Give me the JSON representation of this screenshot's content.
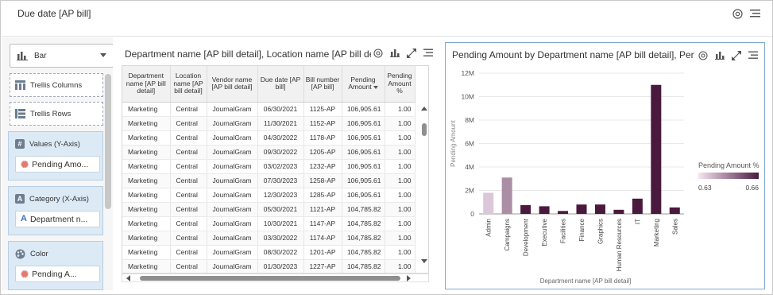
{
  "header": {
    "title": "Due date [AP bill]"
  },
  "left_panel": {
    "chart_type": "Bar",
    "trellis_columns": "Trellis Columns",
    "trellis_rows": "Trellis Rows",
    "values_well": {
      "label": "Values (Y-Axis)",
      "item": "Pending Amo..."
    },
    "category_well": {
      "label": "Category (X-Axis)",
      "item": "Department n..."
    },
    "color_well": {
      "label": "Color",
      "item": "Pending A..."
    }
  },
  "table_panel": {
    "title": "Department name [AP bill detail], Location name [AP bill detail], Ve",
    "columns": [
      "Department name [AP bill detail]",
      "Location name [AP bill detail]",
      "Vendor name [AP bill detail]",
      "Due date [AP bill]",
      "Bill number [AP bill]",
      "Pending Amount",
      "Pending Amount %"
    ],
    "rows": [
      [
        "Marketing",
        "Central",
        "JournalGram",
        "06/30/2021",
        "1125-AP",
        "106,905.61",
        "1.00"
      ],
      [
        "Marketing",
        "Central",
        "JournalGram",
        "11/30/2021",
        "1152-AP",
        "106,905.61",
        "1.00"
      ],
      [
        "Marketing",
        "Central",
        "JournalGram",
        "04/30/2022",
        "1178-AP",
        "106,905.61",
        "1.00"
      ],
      [
        "Marketing",
        "Central",
        "JournalGram",
        "09/30/2022",
        "1205-AP",
        "106,905.61",
        "1.00"
      ],
      [
        "Marketing",
        "Central",
        "JournalGram",
        "03/02/2023",
        "1232-AP",
        "106,905.61",
        "1.00"
      ],
      [
        "Marketing",
        "Central",
        "JournalGram",
        "07/30/2023",
        "1258-AP",
        "106,905.61",
        "1.00"
      ],
      [
        "Marketing",
        "Central",
        "JournalGram",
        "12/30/2023",
        "1285-AP",
        "106,905.61",
        "1.00"
      ],
      [
        "Marketing",
        "Central",
        "JournalGram",
        "05/30/2021",
        "1121-AP",
        "104,785.82",
        "1.00"
      ],
      [
        "Marketing",
        "Central",
        "JournalGram",
        "10/30/2021",
        "1147-AP",
        "104,785.82",
        "1.00"
      ],
      [
        "Marketing",
        "Central",
        "JournalGram",
        "03/30/2022",
        "1174-AP",
        "104,785.82",
        "1.00"
      ],
      [
        "Marketing",
        "Central",
        "JournalGram",
        "08/30/2022",
        "1201-AP",
        "104,785.82",
        "1.00"
      ],
      [
        "Marketing",
        "Central",
        "JournalGram",
        "01/30/2023",
        "1227-AP",
        "104,785.82",
        "1.00"
      ]
    ]
  },
  "chart_panel": {
    "title": "Pending Amount by Department name [AP bill detail], Pending Am"
  },
  "chart_data": {
    "type": "bar",
    "categories": [
      "Admin",
      "Campaigns",
      "Development",
      "Executive",
      "Facilities",
      "Finance",
      "Graphics",
      "Human Resources",
      "IT",
      "Marketing",
      "Sales"
    ],
    "values": [
      1800000,
      3100000,
      750000,
      650000,
      250000,
      800000,
      800000,
      350000,
      1300000,
      11000000,
      550000
    ],
    "color_values": [
      0.63,
      0.64,
      0.66,
      0.66,
      0.66,
      0.66,
      0.66,
      0.66,
      0.66,
      0.66,
      0.66
    ],
    "yticks": [
      "12M",
      "10M",
      "8M",
      "6M",
      "4M",
      "2M",
      "0"
    ],
    "ylim": [
      0,
      12000000
    ],
    "xlabel": "Department name [AP bill detail]",
    "ylabel": "Pending Amount",
    "grid": true,
    "legend": {
      "title": "Pending Amount %",
      "min": "0.63",
      "max": "0.66",
      "placement": "right",
      "color_low": "#f6e6f3",
      "color_high": "#4a1a3e"
    }
  }
}
